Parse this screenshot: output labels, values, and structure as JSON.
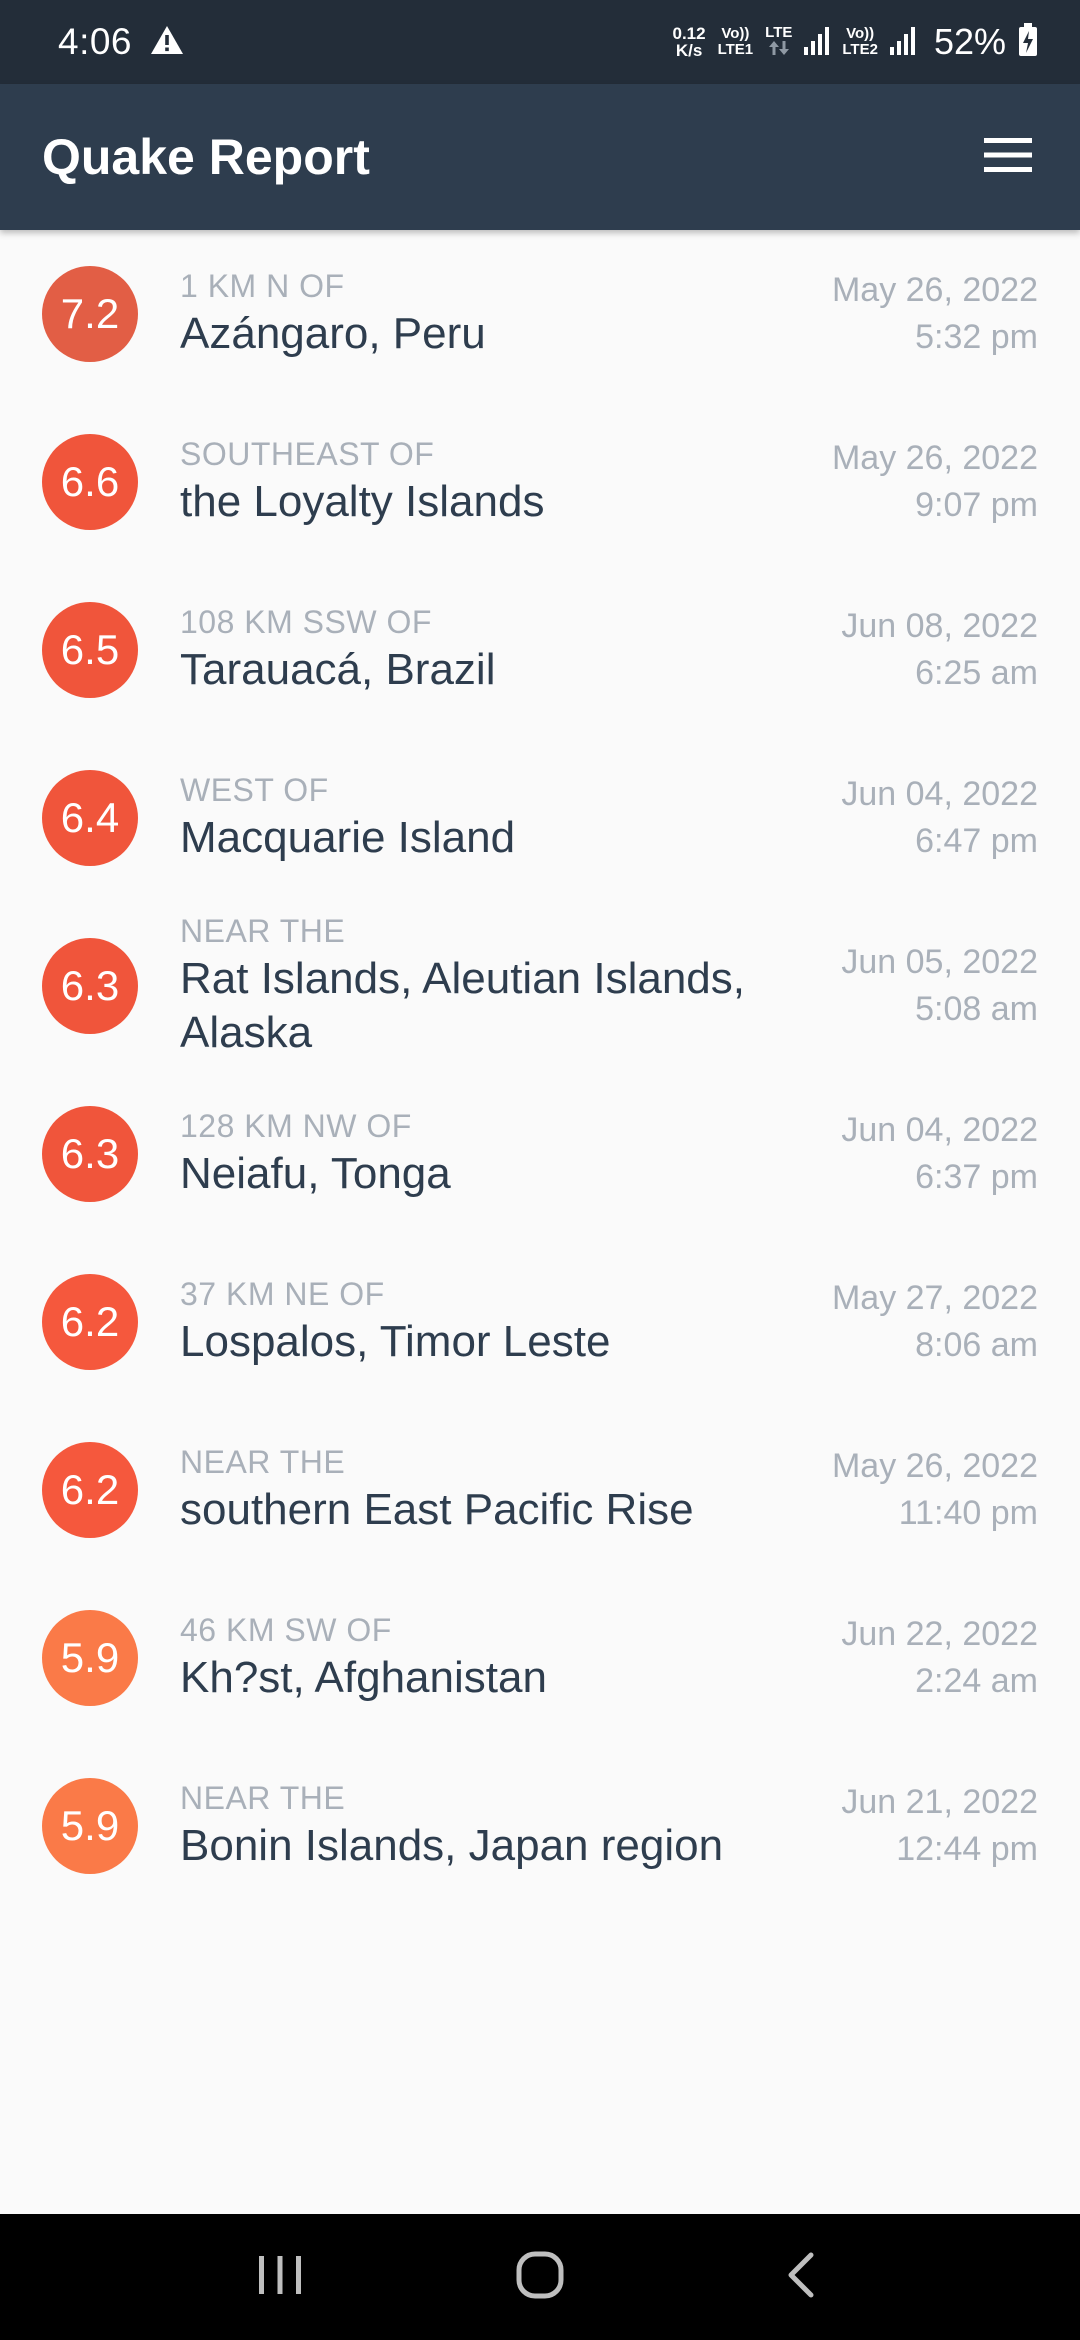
{
  "status_bar": {
    "time": "4:06",
    "net_speed_value": "0.12",
    "net_speed_unit": "K/s",
    "sim1_top": "Vo))",
    "sim1_bottom": "LTE1",
    "lte_label": "LTE",
    "sim2_top": "Vo))",
    "sim2_bottom": "LTE2",
    "battery": "52%"
  },
  "app_bar": {
    "title": "Quake Report"
  },
  "earthquakes": [
    {
      "magnitude": "7.2",
      "color": "#e25e45",
      "offset": "1 KM N OF",
      "place": "Azángaro, Peru",
      "date": "May 26, 2022",
      "time": "5:32 pm"
    },
    {
      "magnitude": "6.6",
      "color": "#f0553b",
      "offset": "SOUTHEAST OF",
      "place": "the Loyalty Islands",
      "date": "May 26, 2022",
      "time": "9:07 pm"
    },
    {
      "magnitude": "6.5",
      "color": "#f0553b",
      "offset": "108 KM SSW OF",
      "place": "Tarauacá, Brazil",
      "date": "Jun 08, 2022",
      "time": "6:25 am"
    },
    {
      "magnitude": "6.4",
      "color": "#f0553b",
      "offset": "WEST OF",
      "place": "Macquarie Island",
      "date": "Jun 04, 2022",
      "time": "6:47 pm"
    },
    {
      "magnitude": "6.3",
      "color": "#f0553b",
      "offset": "NEAR THE",
      "place": "Rat Islands, Aleutian Islands, Alaska",
      "date": "Jun 05, 2022",
      "time": "5:08 am"
    },
    {
      "magnitude": "6.3",
      "color": "#f0553b",
      "offset": "128 KM NW OF",
      "place": "Neiafu, Tonga",
      "date": "Jun 04, 2022",
      "time": "6:37 pm"
    },
    {
      "magnitude": "6.2",
      "color": "#f5583d",
      "offset": "37 KM NE OF",
      "place": "Lospalos, Timor Leste",
      "date": "May 27, 2022",
      "time": "8:06 am"
    },
    {
      "magnitude": "6.2",
      "color": "#f5583d",
      "offset": "NEAR THE",
      "place": "southern East Pacific Rise",
      "date": "May 26, 2022",
      "time": "11:40 pm"
    },
    {
      "magnitude": "5.9",
      "color": "#fa7a48",
      "offset": "46 KM SW OF",
      "place": "Kh?st, Afghanistan",
      "date": "Jun 22, 2022",
      "time": "2:24 am"
    },
    {
      "magnitude": "5.9",
      "color": "#fa7a48",
      "offset": "NEAR THE",
      "place": "Bonin Islands, Japan region",
      "date": "Jun 21, 2022",
      "time": "12:44 pm"
    }
  ],
  "icons": {
    "menu": "menu-icon",
    "warning": "warning-icon",
    "recents": "recents-icon",
    "home": "home-icon",
    "back": "back-icon"
  }
}
